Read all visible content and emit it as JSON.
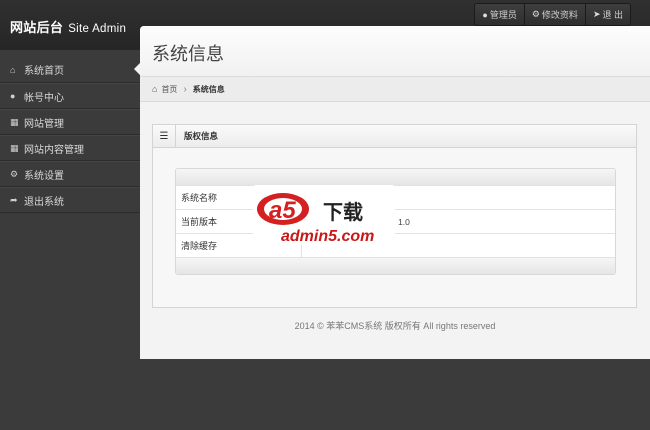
{
  "brand": {
    "title": "网站后台",
    "subtitle": "Site Admin"
  },
  "top_actions": [
    {
      "icon": "user-icon",
      "label": "管理员"
    },
    {
      "icon": "gear-icon",
      "label": "修改资料"
    },
    {
      "icon": "logout-icon",
      "label": "退 出"
    }
  ],
  "sidebar": {
    "items": [
      {
        "icon": "home-icon",
        "label": "系统首页",
        "active": true
      },
      {
        "icon": "user-icon",
        "label": "帐号中心"
      },
      {
        "icon": "grid-icon",
        "label": "网站管理"
      },
      {
        "icon": "grid-icon",
        "label": "网站内容管理"
      },
      {
        "icon": "gear-icon",
        "label": "系统设置"
      },
      {
        "icon": "share-icon",
        "label": "退出系统"
      }
    ]
  },
  "main": {
    "title": "系统信息",
    "breadcrumb": {
      "home": "首页",
      "current": "系统信息"
    },
    "box": {
      "title": "版权信息",
      "rows": [
        {
          "label": "系统名称",
          "value": ""
        },
        {
          "label": "当前版本",
          "value": "1.0"
        },
        {
          "label": "清除缓存",
          "value": ""
        }
      ]
    },
    "footer": "2014 © 苯苯CMS系统 版权所有 All rights reserved"
  },
  "watermark": {
    "brand": "a5",
    "tagline": "下载",
    "url": "admin5.com"
  }
}
